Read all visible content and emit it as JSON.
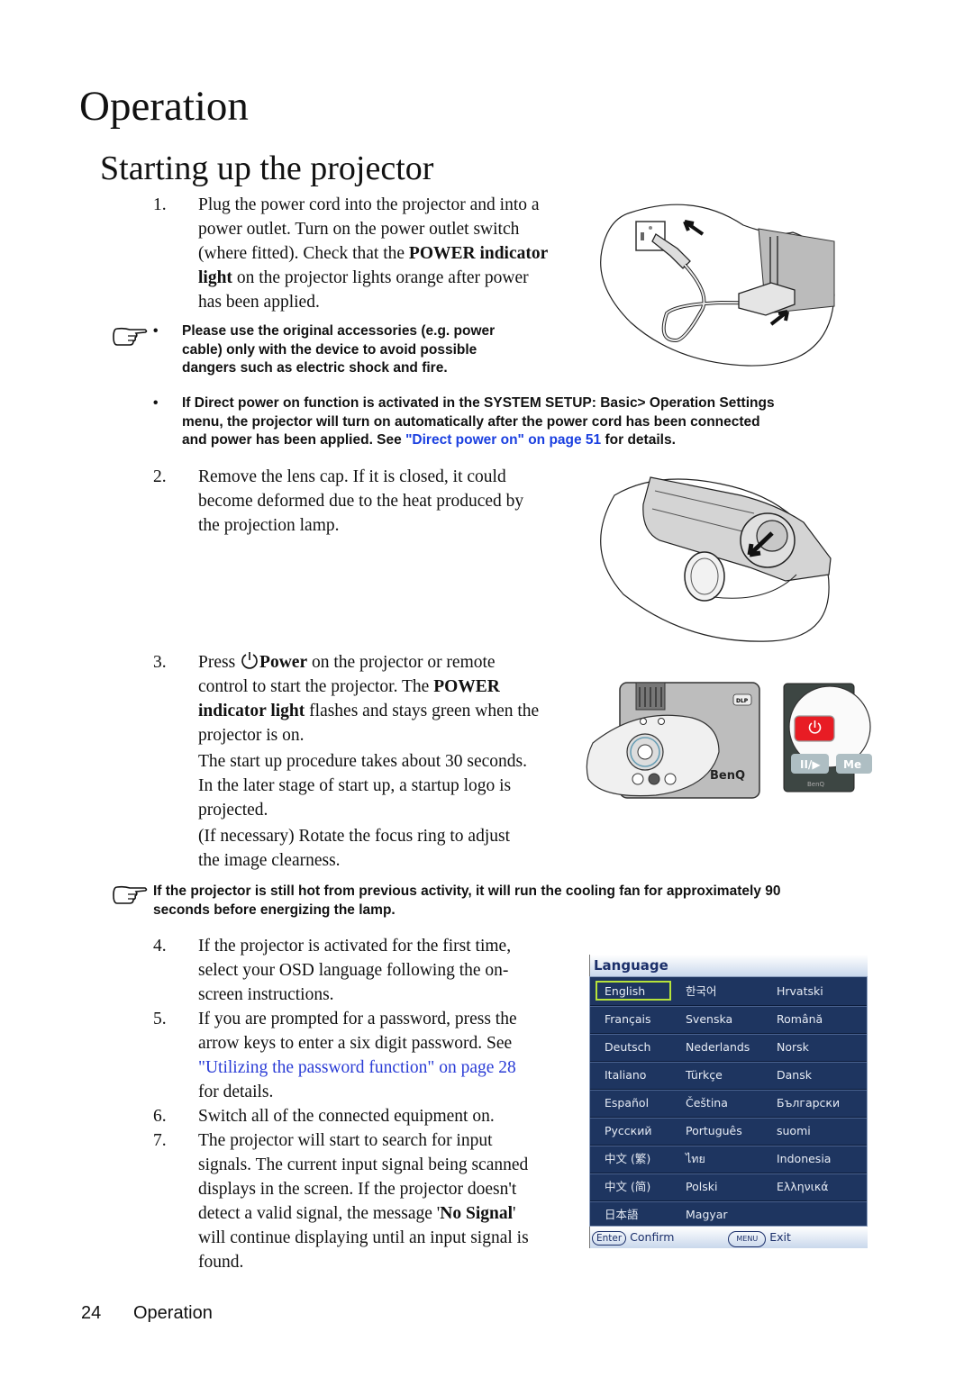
{
  "chapter_title": "Operation",
  "section_title": "Starting up the projector",
  "steps": [
    {
      "num": "1.",
      "lines": [
        "Plug the power cord into the projector and into a",
        "power outlet. Turn on the power outlet switch",
        "(where fitted). Check that the ",
        "light",
        " on the projector lights orange after power",
        "has been applied."
      ],
      "bold_phrase": "POWER indicator"
    },
    {
      "num": "2.",
      "lines": [
        "Remove the lens cap. If it is closed, it could",
        "become deformed due to the heat produced by",
        "the projection lamp."
      ]
    },
    {
      "num": "3.",
      "press": "Press",
      "power_label": "Power",
      "line1_rest": " on the projector or remote",
      "line2_pre": "control to start the projector. The ",
      "line2_bold": "POWER",
      "line3_bold": "indicator light",
      "line3_rest": " flashes and stays green when the",
      "line4": "projector is on.",
      "line5": "The start up procedure takes about 30 seconds.",
      "line6": "In the later stage of start up, a startup logo is",
      "line7": "projected.",
      "line8": "(If necessary) Rotate the focus ring to adjust",
      "line9": "the image clearness."
    },
    {
      "num": "4.",
      "lines": [
        "If the projector is activated for the first time,",
        "select your OSD language following the on-",
        "screen instructions."
      ]
    },
    {
      "num": "5.",
      "lines": [
        "If you are prompted for a password, press the",
        "arrow keys to enter a six digit password. See"
      ],
      "link": "\"Utilizing the password function\" on page 28",
      "after_link": "for details."
    },
    {
      "num": "6.",
      "lines": [
        "Switch all of the connected equipment on."
      ]
    },
    {
      "num": "7.",
      "lines": [
        "The projector will start to search for input",
        "signals. The current input signal being scanned",
        "displays in the screen. If the projector doesn't",
        "detect a valid signal, the message '",
        "'",
        "will continue displaying until an input signal is",
        "found."
      ],
      "bold_phrase": "No Signal"
    }
  ],
  "notes": {
    "note1": {
      "bullet": "•",
      "lines": [
        "Please use the original accessories (e.g. power",
        "cable) only with the device to avoid possible",
        "dangers such as electric shock and fire."
      ]
    },
    "note2": {
      "bullet": "•",
      "lines": [
        "If Direct power on function is activated in the SYSTEM SETUP: Basic> Operation Settings",
        "menu, the projector will turn on automatically after the power cord has been connected",
        "and power has been applied. See "
      ],
      "link": "\"Direct power on\" on page 51",
      "after_link": " for details."
    },
    "note3": {
      "lines": [
        "If the projector is still hot from previous activity, it will run the cooling fan for approximately 90",
        "seconds before energizing the lamp."
      ]
    }
  },
  "osd_menu": {
    "title": "Language",
    "rows": [
      [
        "English",
        "한국어",
        "Hrvatski"
      ],
      [
        "Français",
        "Svenska",
        "Română"
      ],
      [
        "Deutsch",
        "Nederlands",
        "Norsk"
      ],
      [
        "Italiano",
        "Türkçe",
        "Dansk"
      ],
      [
        "Español",
        "Čeština",
        "Български"
      ],
      [
        "Русский",
        "Português",
        "suomi"
      ],
      [
        "中文 (繁)",
        "ไทย",
        "Indonesia"
      ],
      [
        "中文 (简)",
        "Polski",
        "Ελληνικά"
      ],
      [
        "日本語",
        "Magyar",
        ""
      ]
    ],
    "selected": "English",
    "footer": {
      "enter_key": "Enter",
      "confirm": "Confirm",
      "menu_key": "MENU",
      "exit": "Exit"
    }
  },
  "illustrations": {
    "projector_brand": "BenQ",
    "remote_brand": "BenQ",
    "dlp_label": "DLP",
    "remote_play_label": "II/▶",
    "remote_menu_label": "Me"
  },
  "footer": {
    "page_number": "24",
    "chapter": "Operation"
  }
}
